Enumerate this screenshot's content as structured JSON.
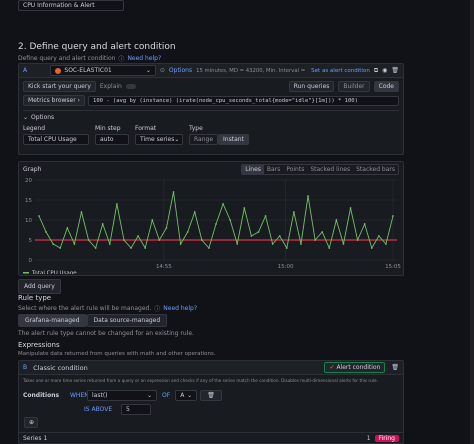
{
  "top_field": {
    "value": "CPU Information & Alert"
  },
  "section2": {
    "title": "2. Define query and alert condition",
    "desc": "Define query and alert condition",
    "help": "Need help?"
  },
  "query": {
    "ref": "A",
    "datasource": "SOC-ELASTIC01",
    "options_label": "Options",
    "options_summary": "15 minutes, MD = 43200, Min. Interval = 15s",
    "set_alert_label": "Set as alert condition",
    "kick_start": "Kick start your query",
    "explain": "Explain",
    "run_queries": "Run queries",
    "builder": "Builder",
    "code": "Code",
    "metrics_browser": "Metrics browser",
    "expr": "100 - (avg by (instance) (irate(node_cpu_seconds_total{mode=\"idle\"}[1m])) * 100)",
    "options_header": "Options",
    "legend_label": "Legend",
    "legend_value": "Total CPU Usage",
    "min_step_label": "Min step",
    "min_step_value": "auto",
    "format_label": "Format",
    "format_value": "Time series",
    "type_label": "Type",
    "type_range": "Range",
    "type_instant": "Instant"
  },
  "graph": {
    "title": "Graph",
    "tabs": [
      "Lines",
      "Bars",
      "Points",
      "Stacked lines",
      "Stacked bars"
    ]
  },
  "chart_data": {
    "type": "line",
    "title": "Graph",
    "series": [
      {
        "name": "Total CPU Usage",
        "color": "#73bf69",
        "values": [
          11,
          7,
          4,
          3,
          8,
          4,
          12,
          5,
          3,
          9,
          4,
          14,
          5,
          3,
          6,
          3,
          10,
          5,
          8,
          17,
          4,
          7,
          12,
          5,
          3,
          9,
          14,
          10,
          4,
          13,
          6,
          7,
          11,
          4,
          6,
          3,
          12,
          4,
          16,
          5,
          7,
          3,
          10,
          4,
          13,
          5,
          9,
          3,
          6,
          4,
          11
        ]
      }
    ],
    "threshold": {
      "value": 5,
      "color": "#e02f44"
    },
    "x_ticks": [
      "14:55",
      "15:00",
      "15:05"
    ],
    "y_ticks": [
      0,
      5,
      10,
      15,
      20
    ],
    "ylim": [
      0,
      20
    ],
    "grid": true,
    "legend": "bottom-left"
  },
  "add_query": "Add query",
  "rule_type": {
    "title": "Rule type",
    "desc": "Select where the alert rule will be managed.",
    "help": "Need help?",
    "grafana_managed": "Grafana-managed",
    "datasource_managed": "Data source-managed",
    "note": "The alert rule type cannot be changed for an existing rule."
  },
  "expressions": {
    "title": "Expressions",
    "desc": "Manipulate data returned from queries with math and other operations.",
    "ref": "B",
    "name": "Classic condition",
    "alert_condition": "Alert condition",
    "info": "Takes one or more time series returned from a query or an expression and checks if any of the series match the condition. Disables multi-dimensional alerts for this rule.",
    "conditions_label": "Conditions",
    "when": "WHEN",
    "reducer": "last()",
    "of": "OF",
    "query_ref": "A",
    "is_above": "IS ABOVE",
    "threshold_value": "5",
    "series_label": "Series 1",
    "series_value": "1",
    "firing": "Firing"
  }
}
